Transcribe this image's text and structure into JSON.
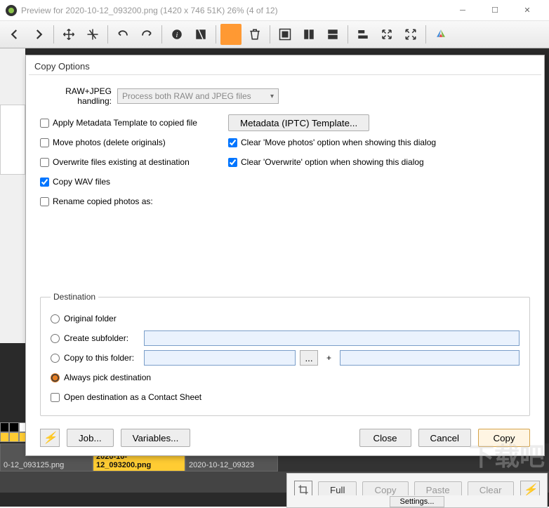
{
  "window": {
    "title": "Preview for 2020-10-12_093200.png (1420 x 746 51K) 26% (4 of 12)"
  },
  "dialog": {
    "title": "Copy Options",
    "raw_label": "RAW+JPEG handling:",
    "raw_value": "Process both RAW and JPEG files",
    "apply_metadata": "Apply Metadata Template to copied file",
    "metadata_btn": "Metadata (IPTC) Template...",
    "move_photos": "Move photos (delete originals)",
    "clear_move": "Clear 'Move photos' option when showing this dialog",
    "overwrite": "Overwrite files existing at destination",
    "clear_overwrite": "Clear 'Overwrite' option when showing this dialog",
    "copy_wav": "Copy WAV files",
    "rename": "Rename copied photos as:"
  },
  "destination": {
    "legend": "Destination",
    "original": "Original folder",
    "create_sub": "Create subfolder:",
    "copy_to": "Copy to this folder:",
    "browse": "...",
    "plus": "+",
    "always_pick": "Always pick destination",
    "open_contact": "Open destination as a Contact Sheet"
  },
  "footer": {
    "flash": "⚡",
    "job": "Job...",
    "variables": "Variables...",
    "close": "Close",
    "cancel": "Cancel",
    "copy": "Copy"
  },
  "thumbs": {
    "t1": "0-12_093125.png",
    "t2": "2020-10-12_093200.png",
    "t3": "2020-10-12_09323"
  },
  "ext": {
    "full": "Full",
    "copy": "Copy",
    "paste": "Paste",
    "clear": "Clear",
    "settings": "Settings..."
  },
  "watermark": "下载吧"
}
